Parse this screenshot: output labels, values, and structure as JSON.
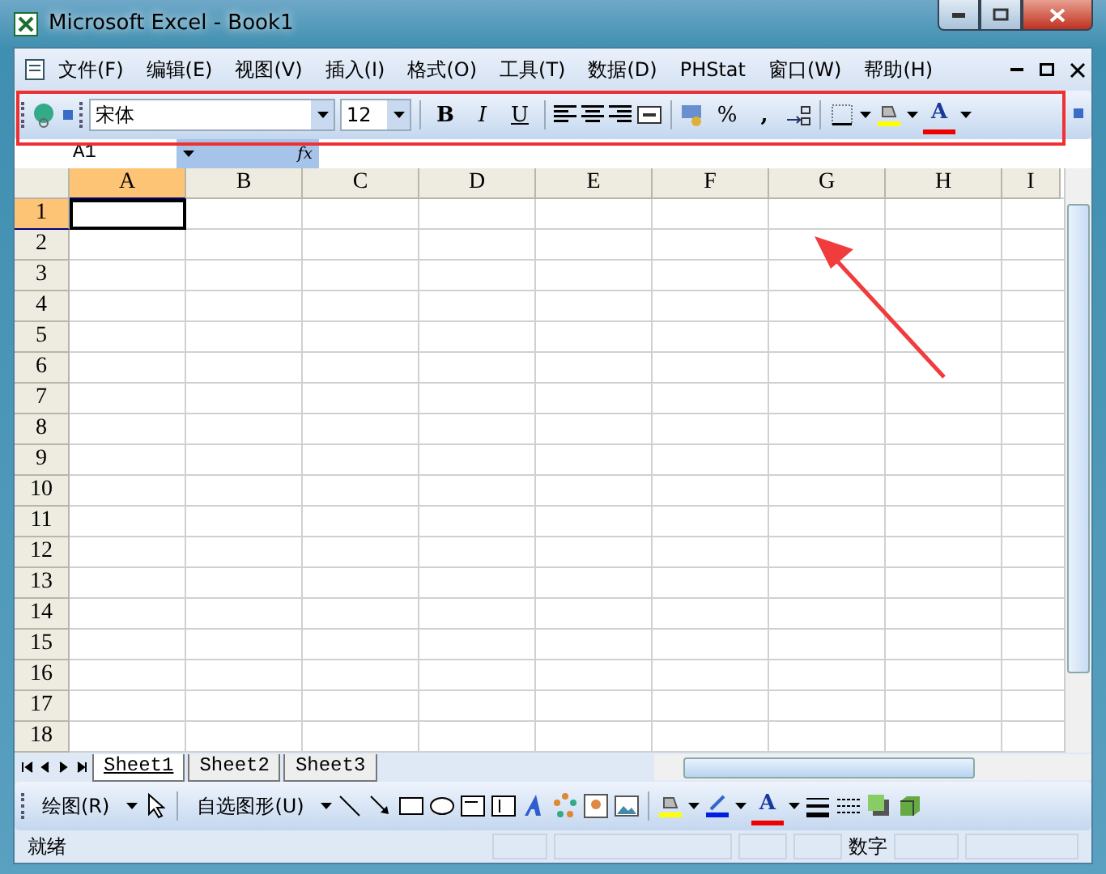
{
  "window": {
    "title": "Microsoft Excel - Book1"
  },
  "menu": [
    "文件(F)",
    "编辑(E)",
    "视图(V)",
    "插入(I)",
    "格式(O)",
    "工具(T)",
    "数据(D)",
    "PHStat",
    "窗口(W)",
    "帮助(H)"
  ],
  "toolbar": {
    "font": "宋体",
    "size": "12",
    "bold": "B",
    "italic": "I",
    "underline": "U",
    "percent": "%",
    "comma": ",",
    "font_color": "A"
  },
  "formula_bar": {
    "name_box": "A1",
    "fx": "fx"
  },
  "columns": [
    {
      "label": "A",
      "selected": true
    },
    {
      "label": "B",
      "selected": false
    },
    {
      "label": "C",
      "selected": false
    },
    {
      "label": "D",
      "selected": false
    },
    {
      "label": "E",
      "selected": false
    },
    {
      "label": "F",
      "selected": false
    },
    {
      "label": "G",
      "selected": false
    },
    {
      "label": "H",
      "selected": false
    },
    {
      "label": "I",
      "selected": false
    }
  ],
  "rows": [
    {
      "label": "1",
      "selected": true
    },
    {
      "label": "2",
      "selected": false
    },
    {
      "label": "3",
      "selected": false
    },
    {
      "label": "4",
      "selected": false
    },
    {
      "label": "5",
      "selected": false
    },
    {
      "label": "6",
      "selected": false
    },
    {
      "label": "7",
      "selected": false
    },
    {
      "label": "8",
      "selected": false
    },
    {
      "label": "9",
      "selected": false
    },
    {
      "label": "10",
      "selected": false
    },
    {
      "label": "11",
      "selected": false
    },
    {
      "label": "12",
      "selected": false
    },
    {
      "label": "13",
      "selected": false
    },
    {
      "label": "14",
      "selected": false
    },
    {
      "label": "15",
      "selected": false
    },
    {
      "label": "16",
      "selected": false
    },
    {
      "label": "17",
      "selected": false
    },
    {
      "label": "18",
      "selected": false
    }
  ],
  "sheets": [
    {
      "label": "Sheet1",
      "selected": true
    },
    {
      "label": "Sheet2",
      "selected": false
    },
    {
      "label": "Sheet3",
      "selected": false
    }
  ],
  "drawing_toolbar": {
    "draw": "绘图(R)",
    "autoshapes": "自选图形(U)",
    "font_color": "A"
  },
  "status_bar": {
    "status": "就绪",
    "mode": "数字"
  },
  "annotations": {
    "highlight_box": true,
    "arrow": true
  }
}
